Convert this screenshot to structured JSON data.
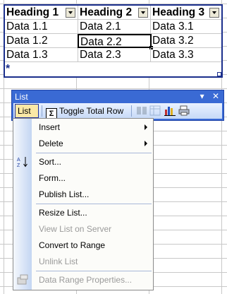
{
  "list_table": {
    "headers": [
      "Heading 1",
      "Heading 2",
      "Heading 3"
    ],
    "rows": [
      [
        "Data 1.1",
        "Data 2.1",
        "Data 3.1"
      ],
      [
        "Data 1.2",
        "Data 2.2",
        "Data 3.2"
      ],
      [
        "Data 1.3",
        "Data 2.3",
        "Data 3.3"
      ]
    ],
    "new_row_marker": "*"
  },
  "toolbar": {
    "title": "List",
    "list_button_label": "List",
    "toggle_total_row_label": "Toggle Total Row",
    "sigma_glyph": "Σ",
    "title_icons": {
      "dropdown": "▾",
      "close": "✕"
    }
  },
  "menu": {
    "items": [
      {
        "label": "Insert",
        "submenu": true,
        "disabled": false
      },
      {
        "label": "Delete",
        "submenu": true,
        "disabled": false
      },
      {
        "label": "Sort...",
        "disabled": false,
        "icon": "sort-az-icon"
      },
      {
        "label": "Form...",
        "disabled": false
      },
      {
        "label": "Publish List...",
        "disabled": false
      },
      {
        "label": "Resize List...",
        "disabled": false
      },
      {
        "label": "View List on Server",
        "disabled": true
      },
      {
        "label": "Convert to Range",
        "disabled": false
      },
      {
        "label": "Unlink List",
        "disabled": true
      },
      {
        "label": "Data Range Properties...",
        "disabled": true,
        "icon": "data-range-icon"
      }
    ],
    "sort_icon_text": "A↓Z"
  },
  "colors": {
    "list_border": "#1b2f8c",
    "toolbar_title_bg": "#3a6ad4",
    "active_button_bg": "#fbe8a6",
    "disabled_text": "#9a9a9a"
  }
}
